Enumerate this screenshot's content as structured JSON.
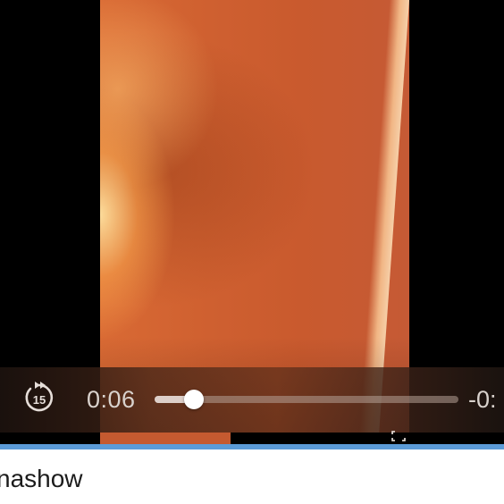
{
  "player": {
    "elapsed": "0:06",
    "remaining": "-0:",
    "progress": 0.13,
    "skip_back_seconds": "15"
  },
  "post": {
    "title": "nashow"
  },
  "colors": {
    "accent_line": "#5b9bd8",
    "video_tone": "#cf6030"
  },
  "icons": {
    "skip_back": "rewind-15-icon",
    "fullscreen": "fullscreen-icon"
  }
}
